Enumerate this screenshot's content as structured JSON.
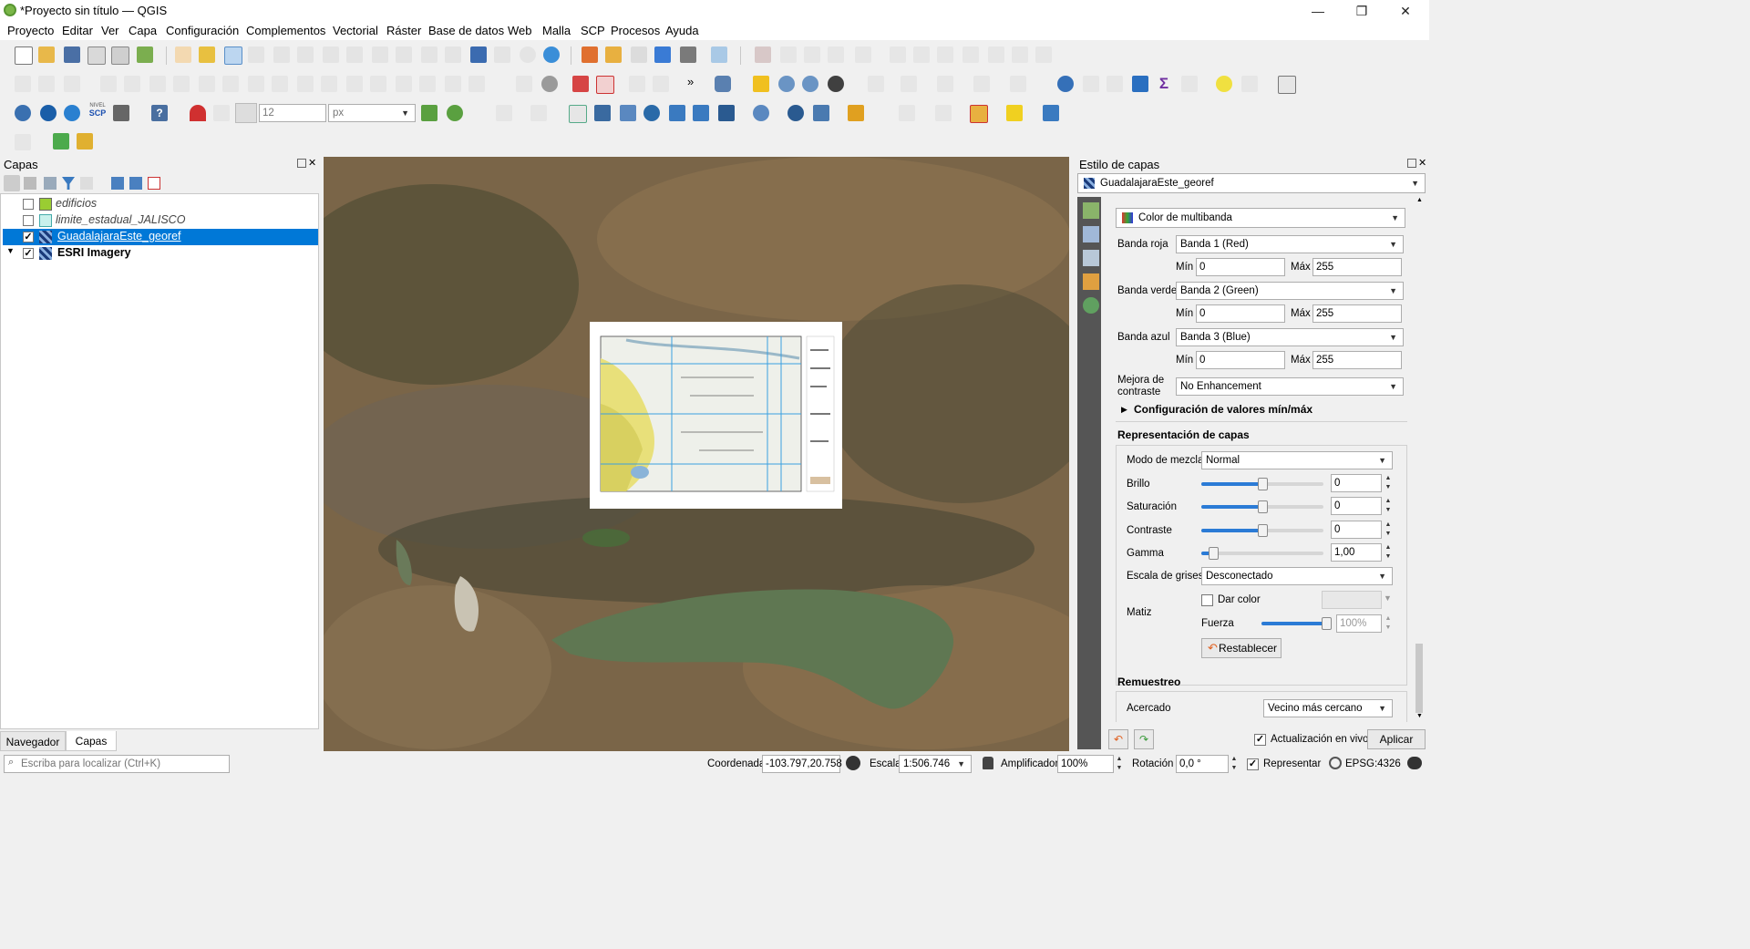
{
  "window": {
    "title": "*Proyecto sin título — QGIS",
    "minimize": "—",
    "maximize": "❐",
    "close": "✕"
  },
  "menu": [
    "Proyecto",
    "Editar",
    "Ver",
    "Capa",
    "Configuración",
    "Complementos",
    "Vectorial",
    "Ráster",
    "Base de datos",
    "Web",
    "Malla",
    "SCP",
    "Procesos",
    "Ayuda"
  ],
  "toolbar": {
    "font_size_value": "12",
    "unit_value": "px",
    "nivel_label": "NIVEL",
    "scp_label": "SCP",
    "more": "»"
  },
  "layers_panel": {
    "title": "Capas",
    "layers": [
      {
        "name": "edificios",
        "checked": false,
        "italic": true
      },
      {
        "name": "limite_estadual_JALISCO",
        "checked": false,
        "italic": true
      },
      {
        "name": "GuadalajaraEste_georef",
        "checked": true,
        "selected": true
      },
      {
        "name": "ESRI Imagery",
        "checked": true,
        "bold": true
      }
    ],
    "tabs": [
      "Navegador",
      "Capas"
    ]
  },
  "style_panel": {
    "title": "Estilo de capas",
    "layer_select": "GuadalajaraEste_georef",
    "renderer": "Color de multibanda",
    "bands": [
      {
        "label": "Banda roja",
        "value": "Banda 1 (Red)",
        "min": "0",
        "max": "255"
      },
      {
        "label": "Banda verde",
        "value": "Banda 2 (Green)",
        "min": "0",
        "max": "255"
      },
      {
        "label": "Banda azul",
        "value": "Banda 3 (Blue)",
        "min": "0",
        "max": "255"
      }
    ],
    "min_label": "Mín",
    "max_label": "Máx",
    "contrast_label": "Mejora de contraste",
    "contrast_value": "No Enhancement",
    "minmax_section": "Configuración de valores mín/máx",
    "rendering_section": "Representación de capas",
    "blend_label": "Modo de mezcla",
    "blend_value": "Normal",
    "brightness": {
      "label": "Brillo",
      "value": "0",
      "level": 0.5
    },
    "saturation": {
      "label": "Saturación",
      "value": "0",
      "level": 0.5
    },
    "contrast": {
      "label": "Contraste",
      "value": "0",
      "level": 0.5
    },
    "gamma": {
      "label": "Gamma",
      "value": "1,00",
      "level": 0.1
    },
    "grayscale_label": "Escala de grises",
    "grayscale_value": "Desconectado",
    "hue_label": "Matiz",
    "colorize_label": "Dar color",
    "strength_label": "Fuerza",
    "strength_value": "100%",
    "strength_level": 1.0,
    "reset_label": "Restablecer",
    "resampling_section": "Remuestreo",
    "zoomed_label": "Acercado",
    "zoomed_value": "Vecino más cercano",
    "live_update_label": "Actualización en vivo",
    "apply_label": "Aplicar"
  },
  "statusbar": {
    "locator_placeholder": "Escriba para localizar (Ctrl+K)",
    "coord_label": "Coordenada",
    "coord_value": "-103.797,20.758",
    "scale_label": "Escala",
    "scale_value": "1:506.746",
    "magnifier_label": "Amplificador",
    "magnifier_value": "100%",
    "rotation_label": "Rotación",
    "rotation_value": "0,0 °",
    "render_label": "Representar",
    "crs": "EPSG:4326"
  },
  "colors": {
    "accent": "#0078d7",
    "selection": "#0078d7",
    "qgis_green": "#589632"
  }
}
